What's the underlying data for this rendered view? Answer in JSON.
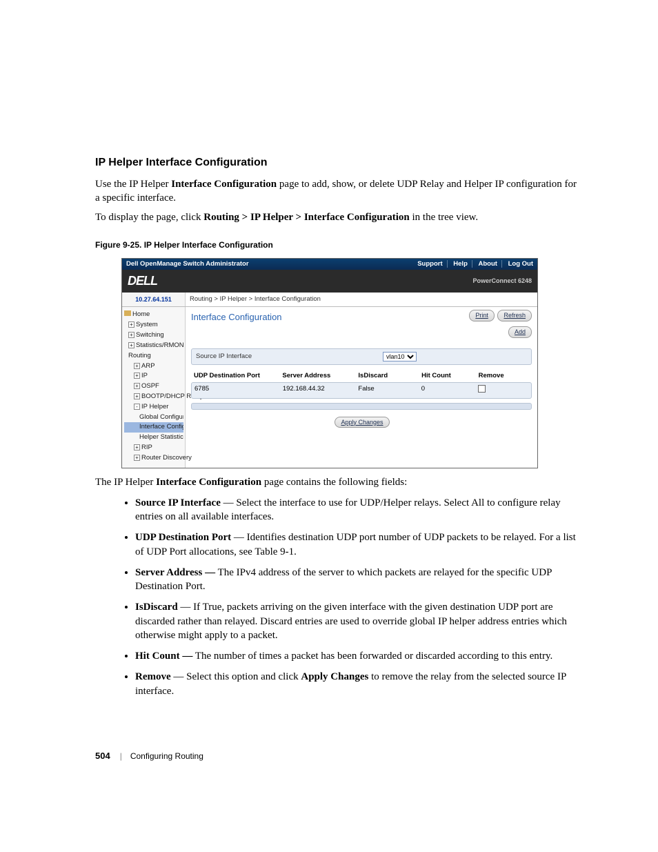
{
  "section": {
    "title": "IP Helper Interface Configuration",
    "intro1_a": "Use the IP Helper ",
    "intro1_bold": "Interface Configuration",
    "intro1_b": " page to add, show, or delete UDP Relay and Helper IP configuration for a specific interface.",
    "intro2_a": "To display the page, click ",
    "intro2_bold": "Routing > IP Helper > Interface Configuration",
    "intro2_b": " in the tree view."
  },
  "figure": {
    "caption": "Figure 9-25.    IP Helper Interface Configuration"
  },
  "shot": {
    "titlebar": {
      "title": "Dell OpenManage Switch Administrator",
      "links": [
        "Support",
        "Help",
        "About",
        "Log Out"
      ]
    },
    "brand": {
      "logo": "DELL",
      "model": "PowerConnect 6248"
    },
    "ip": "10.27.64.151",
    "breadcrumb": "Routing > IP Helper > Interface Configuration",
    "tree": {
      "items": [
        {
          "lvl": 0,
          "icon": "home",
          "label": "Home"
        },
        {
          "lvl": 1,
          "pm": "+",
          "label": "System"
        },
        {
          "lvl": 1,
          "pm": "+",
          "label": "Switching"
        },
        {
          "lvl": 1,
          "pm": "+",
          "label": "Statistics/RMON"
        },
        {
          "lvl": 1,
          "pm": "",
          "label": "Routing"
        },
        {
          "lvl": 2,
          "pm": "+",
          "label": "ARP"
        },
        {
          "lvl": 2,
          "pm": "+",
          "label": "IP"
        },
        {
          "lvl": 2,
          "pm": "+",
          "label": "OSPF"
        },
        {
          "lvl": 2,
          "pm": "+",
          "label": "BOOTP/DHCP Relay A"
        },
        {
          "lvl": 2,
          "pm": "-",
          "label": "IP Helper"
        },
        {
          "lvl": 3,
          "pm": "",
          "label": "Global Configuration"
        },
        {
          "lvl": 3,
          "pm": "",
          "label": "Interface Configurati",
          "sel": true
        },
        {
          "lvl": 3,
          "pm": "",
          "label": "Helper Statistics"
        },
        {
          "lvl": 2,
          "pm": "+",
          "label": "RIP"
        },
        {
          "lvl": 2,
          "pm": "+",
          "label": "Router Discovery"
        }
      ]
    },
    "main": {
      "title": "Interface Configuration",
      "btn_print": "Print",
      "btn_refresh": "Refresh",
      "btn_add": "Add",
      "src_label": "Source IP Interface",
      "src_value": "vlan10",
      "thead": [
        "UDP Destination Port",
        "Server Address",
        "IsDiscard",
        "Hit Count",
        "Remove"
      ],
      "trow": [
        "6785",
        "192.168.44.32",
        "False",
        "0",
        ""
      ],
      "apply": "Apply Changes"
    }
  },
  "after": {
    "lead_a": "The IP Helper ",
    "lead_bold": "Interface Configuration",
    "lead_b": " page contains the following fields:"
  },
  "fields": [
    {
      "term": "Source IP Interface",
      "desc": " — Select the interface to use for UDP/Helper relays. Select All to configure relay entries on all available interfaces."
    },
    {
      "term": "UDP Destination Port",
      "desc": " — Identifies destination UDP port number of UDP packets to be relayed. For a list of UDP Port allocations, see Table 9-1."
    },
    {
      "term": "Server Address —",
      "desc": " The IPv4 address of the server to which packets are relayed for the specific UDP Destination Port."
    },
    {
      "term": "IsDiscard",
      "desc": " — If True, packets arriving on the given interface with the given destination UDP port are discarded rather than relayed. Discard entries are used to override global IP helper address entries which otherwise might apply to a packet."
    },
    {
      "term": "Hit Count —",
      "desc": " The number of times a packet has been forwarded or discarded according to this entry."
    },
    {
      "term": "Remove",
      "desc_a": " — Select this option and click ",
      "desc_bold": "Apply Changes",
      "desc_b": " to remove the relay from the selected source IP interface."
    }
  ],
  "footer": {
    "page": "504",
    "chapter": "Configuring Routing"
  }
}
